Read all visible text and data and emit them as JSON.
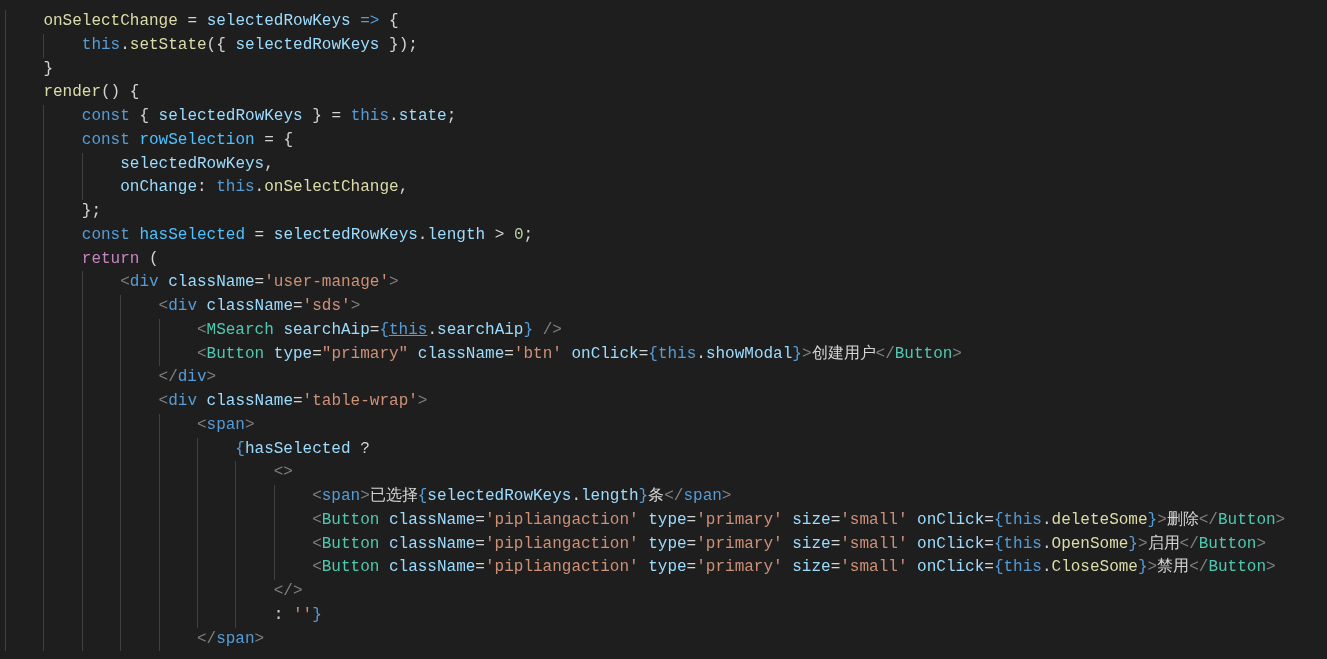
{
  "editor": {
    "lines": [
      {
        "tokens": [
          {
            "text": "onSelectChange",
            "kind": "function"
          },
          {
            "text": " = ",
            "kind": "punct"
          },
          {
            "text": "selectedRowKeys",
            "kind": "variable"
          },
          {
            "text": " => ",
            "kind": "keyword"
          },
          {
            "text": "{",
            "kind": "punct"
          }
        ],
        "children": [
          {
            "tokens": [
              {
                "text": "this",
                "kind": "keyword"
              },
              {
                "text": ".",
                "kind": "punct"
              },
              {
                "text": "setState",
                "kind": "function"
              },
              {
                "text": "({ ",
                "kind": "punct"
              },
              {
                "text": "selectedRowKeys",
                "kind": "variable"
              },
              {
                "text": " });",
                "kind": "punct"
              }
            ]
          }
        ]
      },
      {
        "tokens": [
          {
            "text": "}",
            "kind": "punct"
          }
        ]
      },
      {
        "tokens": [
          {
            "text": "render",
            "kind": "function"
          },
          {
            "text": "() {",
            "kind": "punct"
          }
        ],
        "children": [
          {
            "tokens": [
              {
                "text": "const",
                "kind": "keyword"
              },
              {
                "text": " { ",
                "kind": "punct"
              },
              {
                "text": "selectedRowKeys",
                "kind": "variable"
              },
              {
                "text": " } = ",
                "kind": "punct"
              },
              {
                "text": "this",
                "kind": "keyword"
              },
              {
                "text": ".",
                "kind": "punct"
              },
              {
                "text": "state",
                "kind": "variable"
              },
              {
                "text": ";",
                "kind": "punct"
              }
            ]
          },
          {
            "tokens": [
              {
                "text": "const",
                "kind": "keyword"
              },
              {
                "text": " rowSelection",
                "kind": "constant"
              },
              {
                "text": " = {",
                "kind": "punct"
              }
            ],
            "children": [
              {
                "tokens": [
                  {
                    "text": "selectedRowKeys",
                    "kind": "variable"
                  },
                  {
                    "text": ",",
                    "kind": "punct"
                  }
                ]
              },
              {
                "tokens": [
                  {
                    "text": "onChange",
                    "kind": "variable"
                  },
                  {
                    "text": ": ",
                    "kind": "punct"
                  },
                  {
                    "text": "this",
                    "kind": "keyword"
                  },
                  {
                    "text": ".",
                    "kind": "punct"
                  },
                  {
                    "text": "onSelectChange",
                    "kind": "function"
                  },
                  {
                    "text": ",",
                    "kind": "punct"
                  }
                ]
              }
            ]
          },
          {
            "tokens": [
              {
                "text": "};",
                "kind": "punct"
              }
            ]
          },
          {
            "tokens": [
              {
                "text": "const",
                "kind": "keyword"
              },
              {
                "text": " hasSelected",
                "kind": "constant"
              },
              {
                "text": " = ",
                "kind": "punct"
              },
              {
                "text": "selectedRowKeys",
                "kind": "variable"
              },
              {
                "text": ".",
                "kind": "punct"
              },
              {
                "text": "length",
                "kind": "variable"
              },
              {
                "text": " > ",
                "kind": "punct"
              },
              {
                "text": "0",
                "kind": "number"
              },
              {
                "text": ";",
                "kind": "punct"
              }
            ]
          },
          {
            "tokens": [
              {
                "text": "return",
                "kind": "control"
              },
              {
                "text": " (",
                "kind": "punct"
              }
            ],
            "children": [
              {
                "tokens": [
                  {
                    "text": "<",
                    "kind": "bracket"
                  },
                  {
                    "text": "div",
                    "kind": "html"
                  },
                  {
                    "text": " className",
                    "kind": "attribute"
                  },
                  {
                    "text": "=",
                    "kind": "punct"
                  },
                  {
                    "text": "'user-manage'",
                    "kind": "string"
                  },
                  {
                    "text": ">",
                    "kind": "bracket"
                  }
                ],
                "children": [
                  {
                    "tokens": [
                      {
                        "text": "<",
                        "kind": "bracket"
                      },
                      {
                        "text": "div",
                        "kind": "html"
                      },
                      {
                        "text": " className",
                        "kind": "attribute"
                      },
                      {
                        "text": "=",
                        "kind": "punct"
                      },
                      {
                        "text": "'sds'",
                        "kind": "string"
                      },
                      {
                        "text": ">",
                        "kind": "bracket"
                      }
                    ],
                    "children": [
                      {
                        "tokens": [
                          {
                            "text": "<",
                            "kind": "bracket"
                          },
                          {
                            "text": "MSearch",
                            "kind": "component"
                          },
                          {
                            "text": " searchAip",
                            "kind": "attribute"
                          },
                          {
                            "text": "=",
                            "kind": "punct"
                          },
                          {
                            "text": "{",
                            "kind": "brace"
                          },
                          {
                            "text": "this",
                            "kind": "link"
                          },
                          {
                            "text": ".",
                            "kind": "punct"
                          },
                          {
                            "text": "searchAip",
                            "kind": "variable"
                          },
                          {
                            "text": "}",
                            "kind": "brace"
                          },
                          {
                            "text": " />",
                            "kind": "bracket"
                          }
                        ]
                      },
                      {
                        "tokens": [
                          {
                            "text": "<",
                            "kind": "bracket"
                          },
                          {
                            "text": "Button",
                            "kind": "component"
                          },
                          {
                            "text": " type",
                            "kind": "attribute"
                          },
                          {
                            "text": "=",
                            "kind": "punct"
                          },
                          {
                            "text": "\"primary\"",
                            "kind": "string"
                          },
                          {
                            "text": " className",
                            "kind": "attribute"
                          },
                          {
                            "text": "=",
                            "kind": "punct"
                          },
                          {
                            "text": "'btn'",
                            "kind": "string"
                          },
                          {
                            "text": " onClick",
                            "kind": "attribute"
                          },
                          {
                            "text": "=",
                            "kind": "punct"
                          },
                          {
                            "text": "{",
                            "kind": "brace"
                          },
                          {
                            "text": "this",
                            "kind": "keyword"
                          },
                          {
                            "text": ".",
                            "kind": "punct"
                          },
                          {
                            "text": "showModal",
                            "kind": "variable"
                          },
                          {
                            "text": "}",
                            "kind": "brace"
                          },
                          {
                            "text": ">",
                            "kind": "bracket"
                          },
                          {
                            "text": "创建用户",
                            "kind": "punct"
                          },
                          {
                            "text": "</",
                            "kind": "bracket"
                          },
                          {
                            "text": "Button",
                            "kind": "component"
                          },
                          {
                            "text": ">",
                            "kind": "bracket"
                          }
                        ]
                      }
                    ]
                  },
                  {
                    "tokens": [
                      {
                        "text": "</",
                        "kind": "bracket"
                      },
                      {
                        "text": "div",
                        "kind": "html"
                      },
                      {
                        "text": ">",
                        "kind": "bracket"
                      }
                    ]
                  },
                  {
                    "tokens": [
                      {
                        "text": "<",
                        "kind": "bracket"
                      },
                      {
                        "text": "div",
                        "kind": "html"
                      },
                      {
                        "text": " className",
                        "kind": "attribute"
                      },
                      {
                        "text": "=",
                        "kind": "punct"
                      },
                      {
                        "text": "'table-wrap'",
                        "kind": "string"
                      },
                      {
                        "text": ">",
                        "kind": "bracket"
                      }
                    ],
                    "children": [
                      {
                        "tokens": [
                          {
                            "text": "<",
                            "kind": "bracket"
                          },
                          {
                            "text": "span",
                            "kind": "html"
                          },
                          {
                            "text": ">",
                            "kind": "bracket"
                          }
                        ],
                        "children": [
                          {
                            "tokens": [
                              {
                                "text": "{",
                                "kind": "brace"
                              },
                              {
                                "text": "hasSelected",
                                "kind": "variable"
                              },
                              {
                                "text": " ?",
                                "kind": "punct"
                              }
                            ],
                            "children": [
                              {
                                "tokens": [
                                  {
                                    "text": "<>",
                                    "kind": "bracket"
                                  }
                                ],
                                "children": [
                                  {
                                    "tokens": [
                                      {
                                        "text": "<",
                                        "kind": "bracket"
                                      },
                                      {
                                        "text": "span",
                                        "kind": "html"
                                      },
                                      {
                                        "text": ">",
                                        "kind": "bracket"
                                      },
                                      {
                                        "text": "已选择",
                                        "kind": "punct"
                                      },
                                      {
                                        "text": "{",
                                        "kind": "brace"
                                      },
                                      {
                                        "text": "selectedRowKeys",
                                        "kind": "variable"
                                      },
                                      {
                                        "text": ".",
                                        "kind": "punct"
                                      },
                                      {
                                        "text": "length",
                                        "kind": "variable"
                                      },
                                      {
                                        "text": "}",
                                        "kind": "brace"
                                      },
                                      {
                                        "text": "条",
                                        "kind": "punct"
                                      },
                                      {
                                        "text": "</",
                                        "kind": "bracket"
                                      },
                                      {
                                        "text": "span",
                                        "kind": "html"
                                      },
                                      {
                                        "text": ">",
                                        "kind": "bracket"
                                      }
                                    ]
                                  },
                                  {
                                    "tokens": [
                                      {
                                        "text": "<",
                                        "kind": "bracket"
                                      },
                                      {
                                        "text": "Button",
                                        "kind": "component"
                                      },
                                      {
                                        "text": " className",
                                        "kind": "attribute"
                                      },
                                      {
                                        "text": "=",
                                        "kind": "punct"
                                      },
                                      {
                                        "text": "'pipliangaction'",
                                        "kind": "string"
                                      },
                                      {
                                        "text": " type",
                                        "kind": "attribute"
                                      },
                                      {
                                        "text": "=",
                                        "kind": "punct"
                                      },
                                      {
                                        "text": "'primary'",
                                        "kind": "string"
                                      },
                                      {
                                        "text": " size",
                                        "kind": "attribute"
                                      },
                                      {
                                        "text": "=",
                                        "kind": "punct"
                                      },
                                      {
                                        "text": "'small'",
                                        "kind": "string"
                                      },
                                      {
                                        "text": " onClick",
                                        "kind": "attribute"
                                      },
                                      {
                                        "text": "=",
                                        "kind": "punct"
                                      },
                                      {
                                        "text": "{",
                                        "kind": "brace"
                                      },
                                      {
                                        "text": "this",
                                        "kind": "keyword"
                                      },
                                      {
                                        "text": ".",
                                        "kind": "punct"
                                      },
                                      {
                                        "text": "deleteSome",
                                        "kind": "function"
                                      },
                                      {
                                        "text": "}",
                                        "kind": "brace"
                                      },
                                      {
                                        "text": ">",
                                        "kind": "bracket"
                                      },
                                      {
                                        "text": "删除",
                                        "kind": "punct"
                                      },
                                      {
                                        "text": "</",
                                        "kind": "bracket"
                                      },
                                      {
                                        "text": "Button",
                                        "kind": "component"
                                      },
                                      {
                                        "text": ">",
                                        "kind": "bracket"
                                      }
                                    ]
                                  },
                                  {
                                    "tokens": [
                                      {
                                        "text": "<",
                                        "kind": "bracket"
                                      },
                                      {
                                        "text": "Button",
                                        "kind": "component"
                                      },
                                      {
                                        "text": " className",
                                        "kind": "attribute"
                                      },
                                      {
                                        "text": "=",
                                        "kind": "punct"
                                      },
                                      {
                                        "text": "'pipliangaction'",
                                        "kind": "string"
                                      },
                                      {
                                        "text": " type",
                                        "kind": "attribute"
                                      },
                                      {
                                        "text": "=",
                                        "kind": "punct"
                                      },
                                      {
                                        "text": "'primary'",
                                        "kind": "string"
                                      },
                                      {
                                        "text": " size",
                                        "kind": "attribute"
                                      },
                                      {
                                        "text": "=",
                                        "kind": "punct"
                                      },
                                      {
                                        "text": "'small'",
                                        "kind": "string"
                                      },
                                      {
                                        "text": " onClick",
                                        "kind": "attribute"
                                      },
                                      {
                                        "text": "=",
                                        "kind": "punct"
                                      },
                                      {
                                        "text": "{",
                                        "kind": "brace"
                                      },
                                      {
                                        "text": "this",
                                        "kind": "keyword"
                                      },
                                      {
                                        "text": ".",
                                        "kind": "punct"
                                      },
                                      {
                                        "text": "OpenSome",
                                        "kind": "function"
                                      },
                                      {
                                        "text": "}",
                                        "kind": "brace"
                                      },
                                      {
                                        "text": ">",
                                        "kind": "bracket"
                                      },
                                      {
                                        "text": "启用",
                                        "kind": "punct"
                                      },
                                      {
                                        "text": "</",
                                        "kind": "bracket"
                                      },
                                      {
                                        "text": "Button",
                                        "kind": "component"
                                      },
                                      {
                                        "text": ">",
                                        "kind": "bracket"
                                      }
                                    ]
                                  },
                                  {
                                    "tokens": [
                                      {
                                        "text": "<",
                                        "kind": "bracket"
                                      },
                                      {
                                        "text": "Button",
                                        "kind": "component"
                                      },
                                      {
                                        "text": " className",
                                        "kind": "attribute"
                                      },
                                      {
                                        "text": "=",
                                        "kind": "punct"
                                      },
                                      {
                                        "text": "'pipliangaction'",
                                        "kind": "string"
                                      },
                                      {
                                        "text": " type",
                                        "kind": "attribute"
                                      },
                                      {
                                        "text": "=",
                                        "kind": "punct"
                                      },
                                      {
                                        "text": "'primary'",
                                        "kind": "string"
                                      },
                                      {
                                        "text": " size",
                                        "kind": "attribute"
                                      },
                                      {
                                        "text": "=",
                                        "kind": "punct"
                                      },
                                      {
                                        "text": "'small'",
                                        "kind": "string"
                                      },
                                      {
                                        "text": " onClick",
                                        "kind": "attribute"
                                      },
                                      {
                                        "text": "=",
                                        "kind": "punct"
                                      },
                                      {
                                        "text": "{",
                                        "kind": "brace"
                                      },
                                      {
                                        "text": "this",
                                        "kind": "keyword"
                                      },
                                      {
                                        "text": ".",
                                        "kind": "punct"
                                      },
                                      {
                                        "text": "CloseSome",
                                        "kind": "function"
                                      },
                                      {
                                        "text": "}",
                                        "kind": "brace"
                                      },
                                      {
                                        "text": ">",
                                        "kind": "bracket"
                                      },
                                      {
                                        "text": "禁用",
                                        "kind": "punct"
                                      },
                                      {
                                        "text": "</",
                                        "kind": "bracket"
                                      },
                                      {
                                        "text": "Button",
                                        "kind": "component"
                                      },
                                      {
                                        "text": ">",
                                        "kind": "bracket"
                                      }
                                    ]
                                  }
                                ]
                              },
                              {
                                "tokens": [
                                  {
                                    "text": "</>",
                                    "kind": "bracket"
                                  }
                                ]
                              },
                              {
                                "tokens": [
                                  {
                                    "text": ": ",
                                    "kind": "punct"
                                  },
                                  {
                                    "text": "''",
                                    "kind": "string"
                                  },
                                  {
                                    "text": "}",
                                    "kind": "brace"
                                  }
                                ]
                              }
                            ]
                          }
                        ]
                      },
                      {
                        "tokens": [
                          {
                            "text": "</",
                            "kind": "bracket"
                          },
                          {
                            "text": "span",
                            "kind": "html"
                          },
                          {
                            "text": ">",
                            "kind": "bracket"
                          }
                        ]
                      }
                    ]
                  }
                ]
              }
            ]
          }
        ]
      }
    ]
  }
}
